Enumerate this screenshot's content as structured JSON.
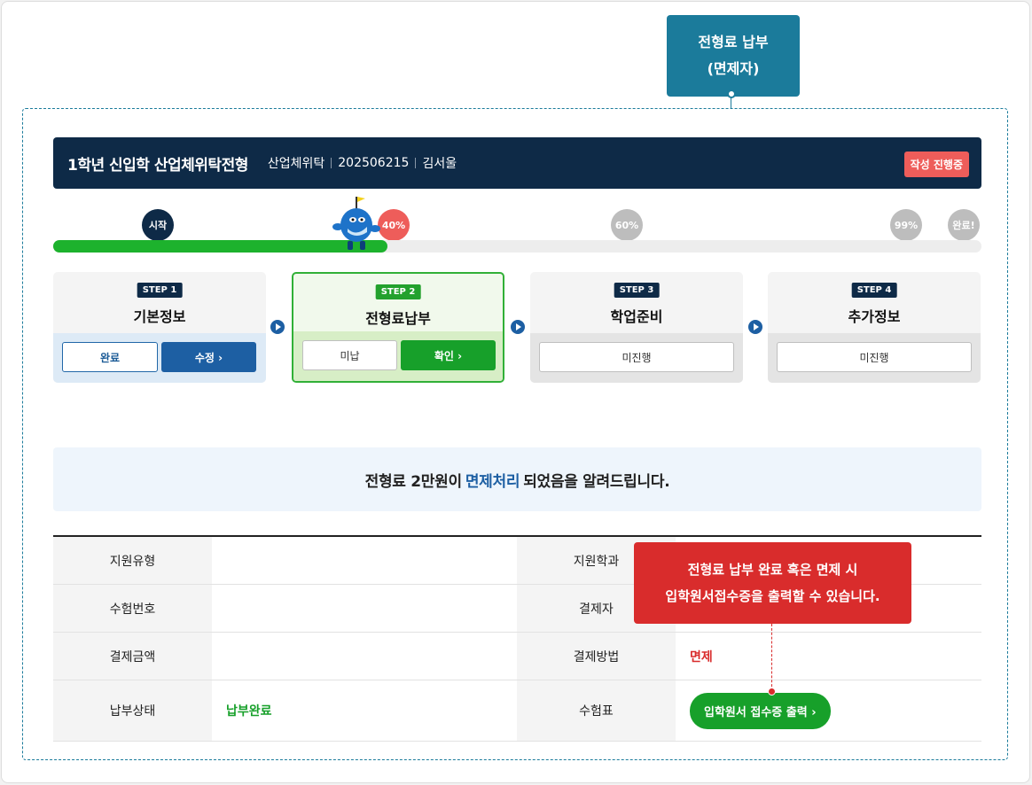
{
  "callout_top": {
    "line1": "전형료 납부",
    "line2": "(면제자)"
  },
  "header": {
    "title": "1학년 신입학 산업체위탁전형",
    "meta": [
      "산업체위탁",
      "202506215",
      "김서울"
    ],
    "badge": "작성 진행중"
  },
  "progress": {
    "percent": 40,
    "markers": [
      "시작",
      "40%",
      "60%",
      "99%",
      "완료!"
    ]
  },
  "steps": [
    {
      "label": "STEP 1",
      "name": "기본정보",
      "status": "완료",
      "action": "수정 ›"
    },
    {
      "label": "STEP 2",
      "name": "전형료납부",
      "status": "미납",
      "action": "확인 ›"
    },
    {
      "label": "STEP 3",
      "name": "학업준비",
      "status": "미진행"
    },
    {
      "label": "STEP 4",
      "name": "추가정보",
      "status": "미진행"
    }
  ],
  "notice": {
    "pre": "전형료 2만원이",
    "highlight": "면제처리",
    "post": "되었음을 알려드립니다."
  },
  "table": {
    "rows": [
      {
        "l_head": "지원유형",
        "l_val": "",
        "r_head": "지원학과",
        "r_val": ""
      },
      {
        "l_head": "수험번호",
        "l_val": "",
        "r_head": "결제자",
        "r_val": ""
      },
      {
        "l_head": "결제금액",
        "l_val": "",
        "r_head": "결제방법",
        "r_val": "면제"
      },
      {
        "l_head": "납부상태",
        "l_val": "납부완료",
        "r_head": "수험표",
        "r_val": ""
      }
    ],
    "print_button": "입학원서 접수증 출력 ›"
  },
  "callout_red": {
    "line1": "전형료 납부 완료 혹은 면제 시",
    "line2": "입학원서접수증을 출력할 수 있습니다."
  }
}
